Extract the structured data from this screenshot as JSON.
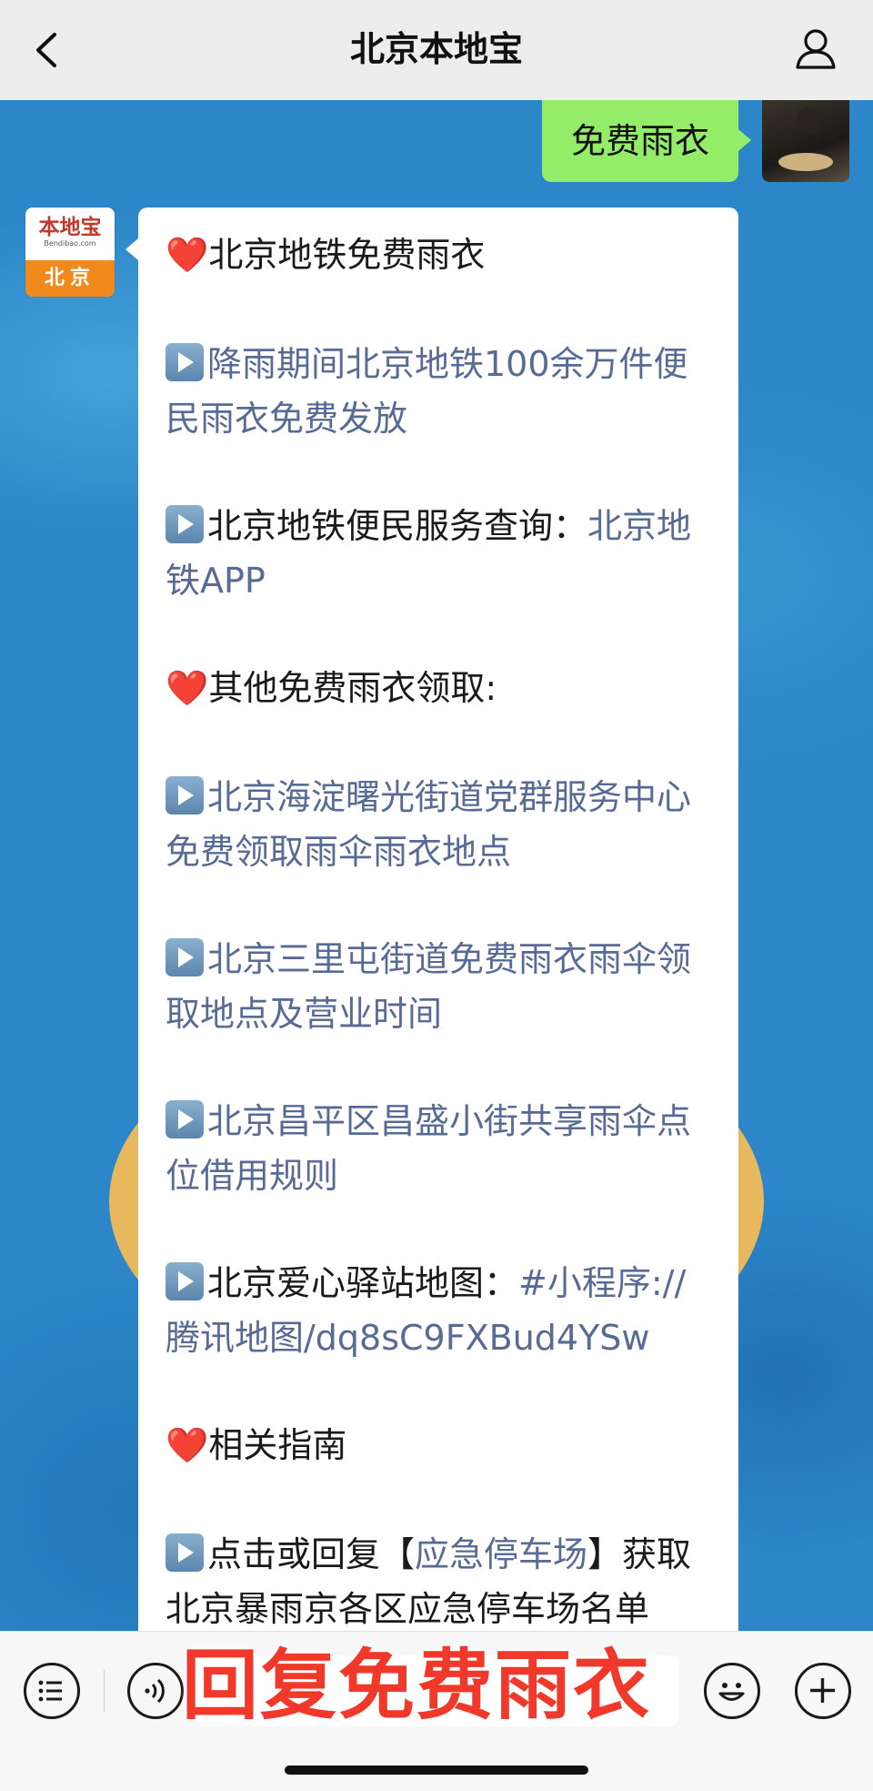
{
  "header": {
    "title": "北京本地宝"
  },
  "sent_message": {
    "text": "免费雨衣"
  },
  "sender_avatar": {
    "logo_text": "本地宝",
    "site_text": "Bendibao.com",
    "city": "北京"
  },
  "reply": [
    {
      "type": "heart",
      "parts": [
        {
          "t": "北京地铁免费雨衣",
          "link": false
        }
      ]
    },
    {
      "type": "play",
      "parts": [
        {
          "t": "降雨期间北京地铁100余万件便民雨衣免费发放",
          "link": true
        }
      ]
    },
    {
      "type": "play",
      "parts": [
        {
          "t": "北京地铁便民服务查询：",
          "link": false
        },
        {
          "t": "北京地铁APP",
          "link": true
        }
      ]
    },
    {
      "type": "heart",
      "parts": [
        {
          "t": "其他免费雨衣领取:",
          "link": false
        }
      ]
    },
    {
      "type": "play",
      "parts": [
        {
          "t": "北京海淀曙光街道党群服务中心免费领取雨伞雨衣地点",
          "link": true
        }
      ]
    },
    {
      "type": "play",
      "parts": [
        {
          "t": "北京三里屯街道免费雨衣雨伞领取地点及营业时间",
          "link": true
        }
      ]
    },
    {
      "type": "play",
      "parts": [
        {
          "t": "北京昌平区昌盛小街共享雨伞点位借用规则",
          "link": true
        }
      ]
    },
    {
      "type": "play",
      "parts": [
        {
          "t": "北京爱心驿站地图：",
          "link": false
        },
        {
          "t": "#小程序://腾讯地图/dq8sC9FXBud4YSw",
          "link": true
        }
      ]
    },
    {
      "type": "heart",
      "parts": [
        {
          "t": "相关指南",
          "link": false
        }
      ]
    },
    {
      "type": "play",
      "parts": [
        {
          "t": "点击或回复【",
          "link": false
        },
        {
          "t": "应急停车场",
          "link": true
        },
        {
          "t": "】获取北京暴雨京各区应急停车场名单",
          "link": false
        }
      ]
    }
  ],
  "overlay": {
    "text": "回复免费雨衣"
  },
  "colors": {
    "link": "#576b95",
    "bubble_green": "#95ec69",
    "chat_bg": "#2c86c8",
    "overlay_red": "#f0392b"
  }
}
